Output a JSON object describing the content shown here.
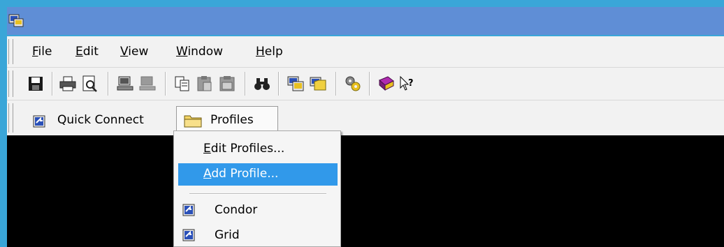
{
  "menubar": {
    "items": [
      {
        "prefix": "",
        "accel": "F",
        "rest": "ile"
      },
      {
        "prefix": "",
        "accel": "E",
        "rest": "dit"
      },
      {
        "prefix": "",
        "accel": "V",
        "rest": "iew"
      },
      {
        "prefix": "",
        "accel": "W",
        "rest": "indow"
      },
      {
        "prefix": "",
        "accel": "H",
        "rest": "elp"
      }
    ]
  },
  "toolbar": {
    "buttons": [
      "save-icon",
      "print-icon",
      "print-preview-icon",
      "connect-icon",
      "disconnect-icon",
      "copy-icon",
      "paste-icon",
      "paste-special-icon",
      "find-icon",
      "session-options-icon",
      "global-options-icon",
      "keymap-icon",
      "help-book-icon",
      "whats-this-icon"
    ]
  },
  "connectbar": {
    "quick_connect_label": "Quick Connect",
    "profiles_label": "Profiles"
  },
  "profiles_menu": {
    "edit": {
      "accel": "E",
      "rest": "dit Profiles..."
    },
    "add": {
      "accel": "A",
      "rest": "dd Profile..."
    },
    "profiles": [
      {
        "label": "Condor"
      },
      {
        "label": "Grid"
      }
    ]
  },
  "colors": {
    "titlebar": "#5f8ed6",
    "highlight": "#3199ea",
    "terminal": "#000000"
  }
}
